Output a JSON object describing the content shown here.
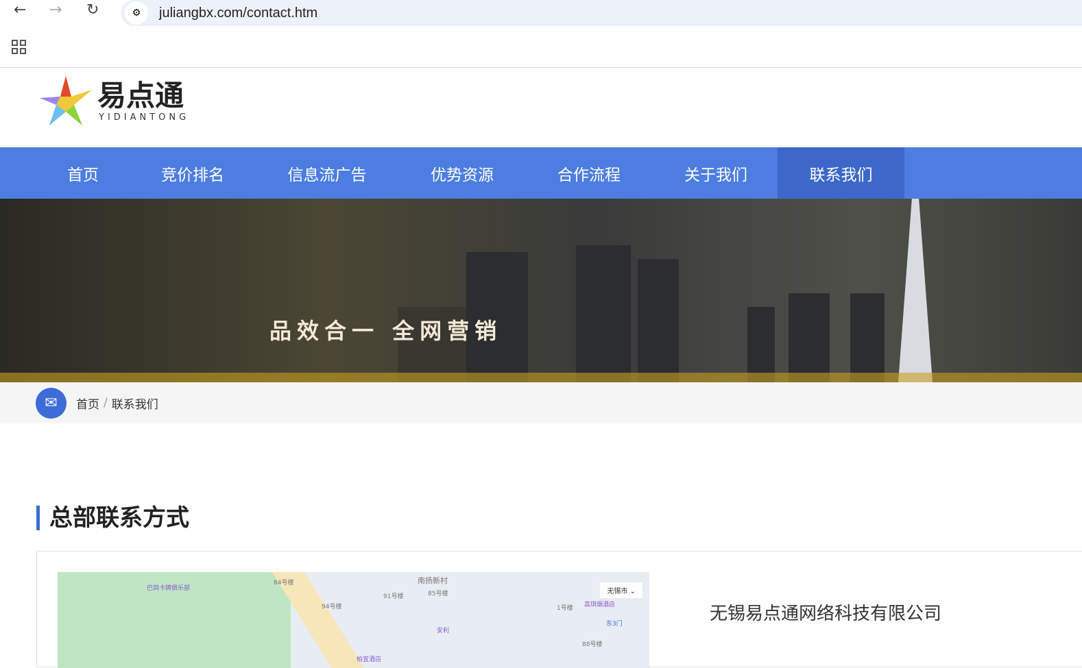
{
  "browser": {
    "url": "juliangbx.com/contact.htm",
    "back": "←",
    "forward": "→",
    "reload": "↻"
  },
  "logo": {
    "name": "易点通",
    "sub": "YIDIANTONG"
  },
  "nav": [
    "首页",
    "竞价排名",
    "信息流广告",
    "优势资源",
    "合作流程",
    "关于我们",
    "联系我们"
  ],
  "banner": {
    "slogan": "品效合一  全网营销"
  },
  "breadcrumb": {
    "home": "首页",
    "sep": "/",
    "current": "联系我们"
  },
  "section": {
    "title": "总部联系方式"
  },
  "map": {
    "city": "无锡市 ⌄",
    "labels": [
      "巴鸽卡牌俱乐部",
      "84号楼",
      "南扬新村",
      "91号楼",
      "85号楼",
      "94号楼",
      "1号楼",
      "高琪烟酒店",
      "东3门",
      "安利",
      "88号楼",
      "柏宜酒店"
    ]
  },
  "company": {
    "name": "无锡易点通网络科技有限公司"
  }
}
